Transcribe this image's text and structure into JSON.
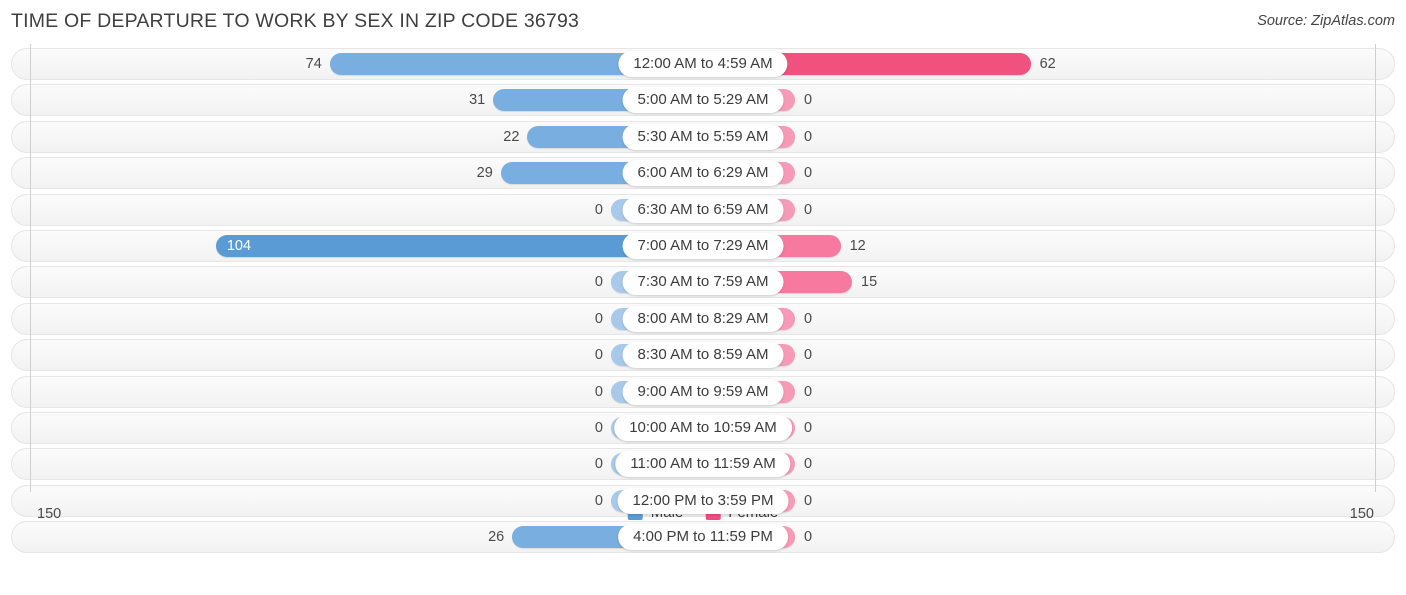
{
  "header": {
    "title": "TIME OF DEPARTURE TO WORK BY SEX IN ZIP CODE 36793",
    "source": "Source: ZipAtlas.com"
  },
  "axis": {
    "left_max": "150",
    "right_max": "150"
  },
  "legend": {
    "items": [
      {
        "label": "Male",
        "color": "#5b9bd5"
      },
      {
        "label": "Female",
        "color": "#ef4b82"
      }
    ]
  },
  "colors": {
    "male_strong": "#5b9bd5",
    "male_mid": "#79aee0",
    "male_light": "#a8c9ea",
    "female_strong": "#f0517f",
    "female_light": "#f79ab8",
    "row_bg": "#f6f6f6",
    "row_border": "#e6e6e6",
    "axis_line": "#cfcfcf"
  },
  "chart_data": {
    "type": "bar",
    "subtype": "diverging-bar",
    "title": "TIME OF DEPARTURE TO WORK BY SEX IN ZIP CODE 36793",
    "xlabel": "",
    "ylabel": "",
    "xlim": [
      150,
      150
    ],
    "grid": false,
    "legend_position": "bottom-center",
    "categories": [
      "12:00 AM to 4:59 AM",
      "5:00 AM to 5:29 AM",
      "5:30 AM to 5:59 AM",
      "6:00 AM to 6:29 AM",
      "6:30 AM to 6:59 AM",
      "7:00 AM to 7:29 AM",
      "7:30 AM to 7:59 AM",
      "8:00 AM to 8:29 AM",
      "8:30 AM to 8:59 AM",
      "9:00 AM to 9:59 AM",
      "10:00 AM to 10:59 AM",
      "11:00 AM to 11:59 AM",
      "12:00 PM to 3:59 PM",
      "4:00 PM to 11:59 PM"
    ],
    "series": [
      {
        "name": "Male",
        "values": [
          74,
          31,
          22,
          29,
          0,
          104,
          0,
          0,
          0,
          0,
          0,
          0,
          0,
          26
        ]
      },
      {
        "name": "Female",
        "values": [
          62,
          0,
          0,
          0,
          0,
          12,
          15,
          0,
          0,
          0,
          0,
          0,
          0,
          0
        ]
      }
    ]
  }
}
